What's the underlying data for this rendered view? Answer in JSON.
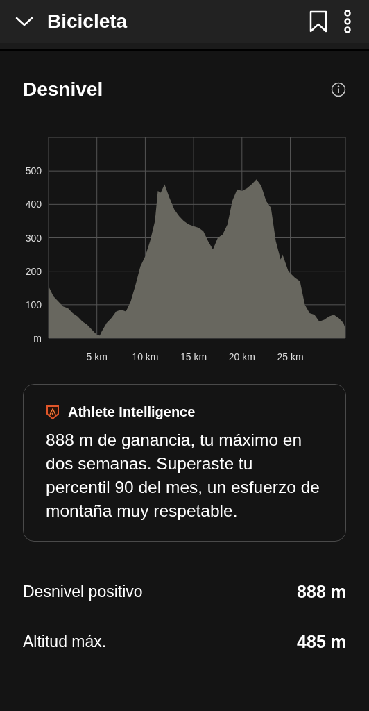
{
  "header": {
    "title": "Bicicleta"
  },
  "section": {
    "title": "Desnivel",
    "chart_data": {
      "type": "area",
      "grid": true,
      "xlim": [
        0,
        30.7
      ],
      "ylim": [
        0,
        600
      ],
      "xticks": [
        {
          "value": 5,
          "label": "5 km"
        },
        {
          "value": 10,
          "label": "10 km"
        },
        {
          "value": 15,
          "label": "15 km"
        },
        {
          "value": 20,
          "label": "20 km"
        },
        {
          "value": 25,
          "label": "25 km"
        }
      ],
      "yticks": [
        {
          "value": 0,
          "label": "m"
        },
        100,
        200,
        300,
        400,
        500
      ],
      "x": [
        0,
        0.5,
        1,
        1.5,
        2,
        2.5,
        3,
        3.5,
        4,
        4.5,
        5,
        5.3,
        5.5,
        6,
        6.5,
        7,
        7.5,
        8,
        8.5,
        9,
        9.5,
        10,
        10.5,
        11,
        11.3,
        11.6,
        12,
        12.5,
        13,
        13.5,
        14,
        14.5,
        15,
        15.5,
        16,
        16.5,
        17,
        17.5,
        18,
        18.5,
        19,
        19.5,
        20,
        20.5,
        21,
        21.5,
        22,
        22.5,
        23,
        23.5,
        24,
        24.2,
        24.8,
        25.5,
        26,
        26.5,
        27,
        27.5,
        28,
        28.5,
        29,
        29.5,
        30,
        30.5,
        30.7
      ],
      "series": [
        {
          "color": "#68675f",
          "values": [
            155,
            125,
            110,
            95,
            90,
            75,
            65,
            50,
            40,
            25,
            10,
            8,
            20,
            45,
            60,
            80,
            85,
            80,
            110,
            160,
            215,
            245,
            290,
            350,
            440,
            435,
            460,
            420,
            385,
            365,
            350,
            340,
            335,
            330,
            320,
            290,
            265,
            300,
            310,
            340,
            410,
            445,
            440,
            448,
            460,
            475,
            455,
            410,
            390,
            290,
            235,
            250,
            200,
            180,
            170,
            100,
            75,
            70,
            50,
            55,
            65,
            70,
            60,
            45,
            28
          ]
        }
      ]
    }
  },
  "insight": {
    "title": "Athlete Intelligence",
    "text": "888 m de ganancia, tu máximo en dos semanas. Superaste tu percentil 90 del mes, un esfuerzo de montaña muy respetable."
  },
  "stats": [
    {
      "label": "Desnivel positivo",
      "value": "888 m"
    },
    {
      "label": "Altitud máx.",
      "value": "485 m"
    }
  ]
}
